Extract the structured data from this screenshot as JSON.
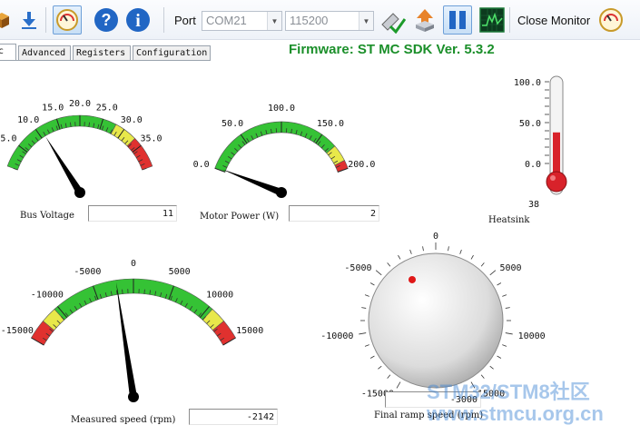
{
  "toolbar": {
    "port_label": "Port",
    "port_value": "COM21",
    "baud_value": "115200",
    "close_monitor_label": "Close Monitor"
  },
  "tabs": [
    "c",
    "Advanced",
    "Registers",
    "Configuration"
  ],
  "firmware": "Firmware: ST MC SDK Ver. 5.3.2",
  "bus_voltage": {
    "label": "Bus Voltage",
    "value": "11",
    "ticks": [
      "5.0",
      "10.0",
      "15.0",
      "20.0",
      "25.0",
      "30.0",
      "35.0"
    ],
    "scale_min": 0,
    "scale_max": 40,
    "reading": 11
  },
  "motor_power": {
    "label": "Motor Power  (W)",
    "value": "2",
    "ticks": [
      "0.0",
      "50.0",
      "100.0",
      "150.0",
      "200.0"
    ],
    "scale_min": 0,
    "scale_max": 200,
    "reading": 2
  },
  "heatsink": {
    "label": "Heatsink",
    "value": "38",
    "ticks": [
      "100.0",
      "50.0",
      "0.0"
    ],
    "scale_min": 0,
    "scale_max": 100,
    "reading": 38
  },
  "measured_speed": {
    "label": "Measured speed  (rpm)",
    "value": "-2142",
    "ticks": [
      "-15000",
      "-10000",
      "-5000",
      "0",
      "5000",
      "10000",
      "15000"
    ],
    "scale_min": -15000,
    "scale_max": 15000,
    "reading": -2142
  },
  "final_ramp_speed": {
    "label": "Final ramp speed  (rpm)",
    "value": "-3000",
    "ticks_left": [
      "-5000",
      "-10000",
      "-15000"
    ],
    "ticks_right": [
      "5000",
      "10000",
      "15000"
    ],
    "tick_top": "0",
    "scale_min": -15000,
    "scale_max": 15000,
    "reading": -3000
  },
  "watermark": {
    "line1": "STM32/STM8社区",
    "line2": "www.stmcu.org.cn"
  }
}
